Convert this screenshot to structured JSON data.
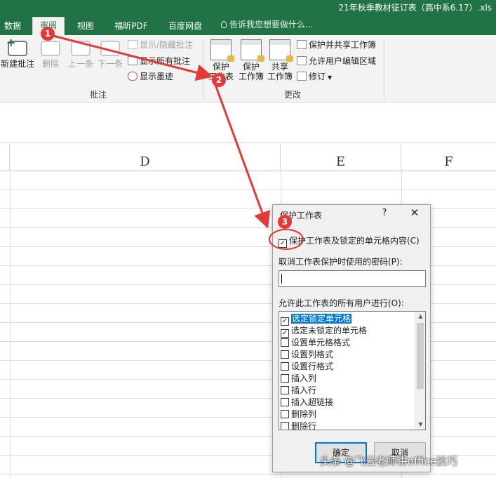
{
  "window": {
    "title": "21年秋季教材征订表（高中系6.17）.xls"
  },
  "tabs": [
    {
      "label": "数据"
    },
    {
      "label": "审阅"
    },
    {
      "label": "视图"
    },
    {
      "label": "福昕PDF"
    },
    {
      "label": "百度网盘"
    }
  ],
  "tell_me": "告诉我您想要做什么...",
  "ribbon": {
    "comments": {
      "new_comment": "新建批注",
      "delete": "删除",
      "previous": "上一条",
      "next": "下一条",
      "show_hide": "显示/隐藏批注",
      "show_all": "显示所有批注",
      "show_ink": "显示墨迹",
      "group_label": "批注"
    },
    "changes": {
      "protect_sheet_line1": "保护",
      "protect_sheet_line2": "工作表",
      "protect_workbook_line1": "保护",
      "protect_workbook_line2": "工作簿",
      "share_workbook_line1": "共享",
      "share_workbook_line2": "工作簿",
      "protect_share": "保护并共享工作簿",
      "allow_edit_ranges": "允许用户编辑区域",
      "track_changes": "修订",
      "group_label": "更改"
    }
  },
  "columns": [
    "D",
    "E",
    "F"
  ],
  "dialog": {
    "title": "保护工作表",
    "help": "?",
    "close": "✕",
    "protect_check_label": "保护工作表及锁定的单元格内容(C)",
    "protect_checked": true,
    "password_label": "取消工作表保护时使用的密码(P):",
    "password_value": "",
    "permissions_label": "允许此工作表的所有用户进行(O):",
    "permissions": [
      {
        "label": "选定锁定单元格",
        "checked": true,
        "selected": true
      },
      {
        "label": "选定未锁定的单元格",
        "checked": true,
        "selected": false
      },
      {
        "label": "设置单元格格式",
        "checked": false,
        "selected": false
      },
      {
        "label": "设置列格式",
        "checked": false,
        "selected": false
      },
      {
        "label": "设置行格式",
        "checked": false,
        "selected": false
      },
      {
        "label": "插入列",
        "checked": false,
        "selected": false
      },
      {
        "label": "插入行",
        "checked": false,
        "selected": false
      },
      {
        "label": "插入超链接",
        "checked": false,
        "selected": false
      },
      {
        "label": "删除列",
        "checked": false,
        "selected": false
      },
      {
        "label": "删除行",
        "checked": false,
        "selected": false
      }
    ],
    "ok": "确定",
    "cancel": "取消"
  },
  "annotations": {
    "step1": "1",
    "step2": "2",
    "step3": "3",
    "color": "#e53935"
  },
  "watermark": "头条 @飞云老师讲office技巧",
  "colors": {
    "ribbon_green": "#217346",
    "selection_blue": "#0078d7"
  }
}
